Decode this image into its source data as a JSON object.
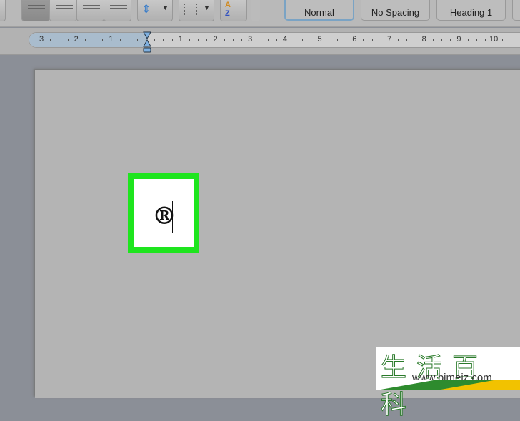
{
  "toolbar": {
    "align_buttons": [
      {
        "icon": "align-left-icon",
        "selected": true
      },
      {
        "icon": "align-center-icon"
      },
      {
        "icon": "align-right-icon"
      },
      {
        "icon": "align-justify-icon"
      }
    ],
    "line_spacing_icon": "line-spacing-icon",
    "borders_icon": "borders-icon",
    "sort_icon": "sort-az-icon"
  },
  "styles": [
    {
      "label": "Normal",
      "active": true
    },
    {
      "label": "No Spacing"
    },
    {
      "label": "Heading 1"
    }
  ],
  "ruler": {
    "labels": [
      "3",
      "2",
      "1",
      "",
      "1",
      "2",
      "3",
      "4",
      "5",
      "6",
      "7",
      "8",
      "9",
      "10"
    ]
  },
  "document": {
    "content": "®",
    "highlight_color": "#1ee51e"
  },
  "watermark": {
    "chinese": "生活百科",
    "url": "www.bimeiz.com"
  }
}
